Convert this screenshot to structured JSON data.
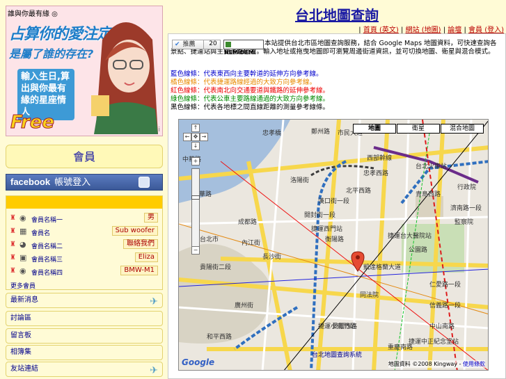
{
  "ad": {
    "badge": "誰與你最有緣 ◎",
    "line1": "占算你的愛注定",
    "line2": "是屬了誰的存在?",
    "line3": "輸入生日,算出與你最有緣的星座情人",
    "free": "Free",
    "info": "i"
  },
  "sidebar": {
    "title": "會員",
    "facebook_brand": "facebook",
    "facebook_label": "帳號登入",
    "online_users": [
      {
        "name": "會員名稱一",
        "badge": "男"
      },
      {
        "name": "會員名",
        "badge": "Sub woofer"
      },
      {
        "name": "會員名稱二",
        "badge": "聯絡我們"
      },
      {
        "name": "會員名稱三",
        "badge": "Eliza"
      },
      {
        "name": "會員名稱四",
        "badge": "BMW-M1"
      }
    ],
    "online_more": "更多會員",
    "links": [
      "最新消息",
      "討論區",
      "留言板",
      "相簿集",
      "友站連結"
    ]
  },
  "header": {
    "title": "台北地圖查詢",
    "nav": [
      "首頁 (英文)",
      "網站 (地圖)",
      "論壇",
      "會員 (登入)"
    ]
  },
  "toolbar": {
    "recommend_label": "推薦",
    "recommend_count": "20",
    "hemidemi_label": "HEMiDEMi"
  },
  "intro": "本站提供台北市區地圖查詢服務，結合 Google Maps 地圖資料，可快速查詢各景點、捷運站與主要道路位置。輸入地址或拖曳地圖即可瀏覽周邊街道資訊，並可切換地圖、衛星與混合模式。",
  "legend": [
    {
      "text": "藍色線條：代表東西向主要幹道的延伸方向參考線。",
      "color": "blue"
    },
    {
      "text": "橘色線條：代表捷運路線經過的大致方向參考線。",
      "color": "orange"
    },
    {
      "text": "紅色線條：代表南北向交通要道與鐵路的延伸參考線。",
      "color": "red"
    },
    {
      "text": "綠色線條：代表公車主要路線通過的大致方向參考線。",
      "color": "green"
    },
    {
      "text": "黑色線條：代表各地標之間直線距離的測量參考線條。",
      "color": "black"
    }
  ],
  "map": {
    "types": [
      "地圖",
      "衛星",
      "混合地圖"
    ],
    "copyright": "地圖資料 ©2008 Kingway -",
    "terms": "使用條款",
    "google": "Google",
    "labels": [
      "忠孝橋",
      "市民大道",
      "鄭州路",
      "台北火車站",
      "西部幹線",
      "忠孝西路",
      "北平西路",
      "長安西路",
      "漢口街一段",
      "開封街一段",
      "洛陽街",
      "成都路",
      "長沙街",
      "內江街",
      "貴陽街二段",
      "中華路",
      "衡陽路",
      "愛國西路",
      "廣州街",
      "凱達格蘭大道",
      "仁愛路一段",
      "信義路一段",
      "中山南路",
      "捷運西門站",
      "捷運台大醫院站",
      "捷運小南門站",
      "行政院",
      "監察院",
      "青島西路",
      "濟南路一段",
      "同法院",
      "和平西路",
      "台北市",
      "公園路",
      "重慶南路",
      "捷運中正紀念堂站"
    ]
  },
  "caption": "台北地圖查詢系統"
}
